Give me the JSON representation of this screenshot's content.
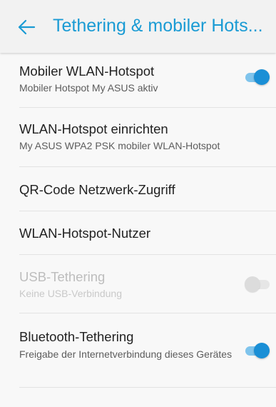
{
  "header": {
    "back_icon": "arrow-left-icon",
    "title": "Tethering & mobiler Hots..."
  },
  "colors": {
    "accent": "#1a9bd4",
    "toggle_on": "#1a8fd6",
    "background": "#f8f8f8"
  },
  "settings": [
    {
      "title": "Mobiler WLAN-Hotspot",
      "subtitle": "Mobiler Hotspot My ASUS aktiv",
      "toggle": "on"
    },
    {
      "title": "WLAN-Hotspot einrichten",
      "subtitle": "My ASUS WPA2 PSK mobiler WLAN-Hotspot"
    },
    {
      "title": "QR-Code Netzwerk-Zugriff"
    },
    {
      "title": "WLAN-Hotspot-Nutzer"
    },
    {
      "title": "USB-Tethering",
      "subtitle": "Keine USB-Verbindung",
      "toggle": "off",
      "enabled": false
    },
    {
      "title": "Bluetooth-Tethering",
      "subtitle": "Freigabe der Internetverbindung dieses Gerätes",
      "toggle": "on"
    }
  ]
}
